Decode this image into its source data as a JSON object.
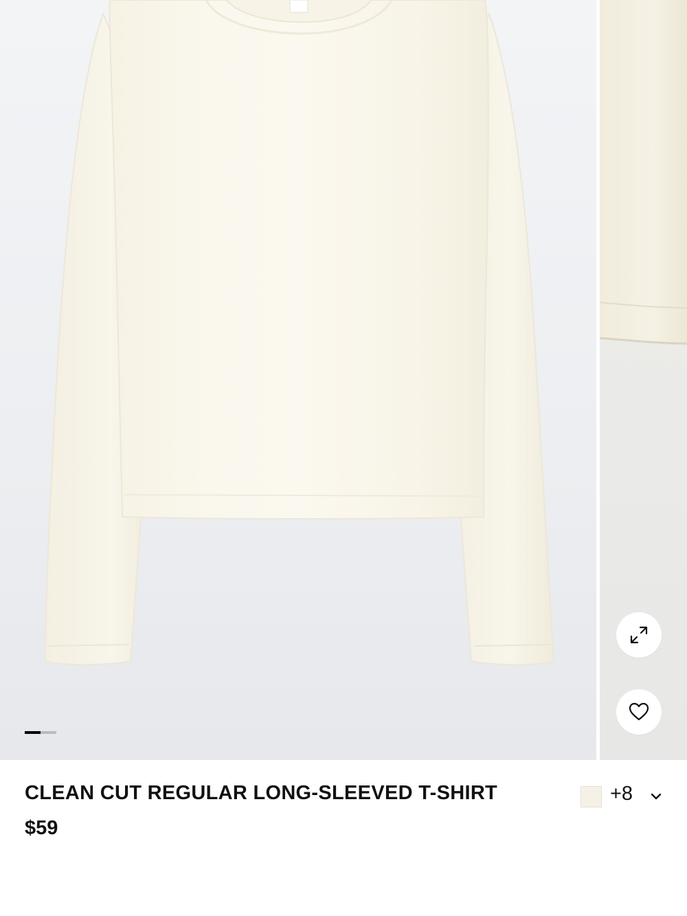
{
  "product": {
    "title": "CLEAN CUT REGULAR LONG-SLEEVED T-SHIRT",
    "price": "$59",
    "image_alt": "Ivory long-sleeved t-shirt",
    "color_swatch": "#f5f1e6",
    "more_colors": "+8"
  },
  "gallery": {
    "slide_count": 2,
    "current_slide": 1,
    "background": "#eceef1",
    "garment_color": "#f8f5ea"
  },
  "icons": {
    "expand": "expand-icon",
    "wishlist": "heart-icon",
    "dropdown": "chevron-down-icon"
  }
}
